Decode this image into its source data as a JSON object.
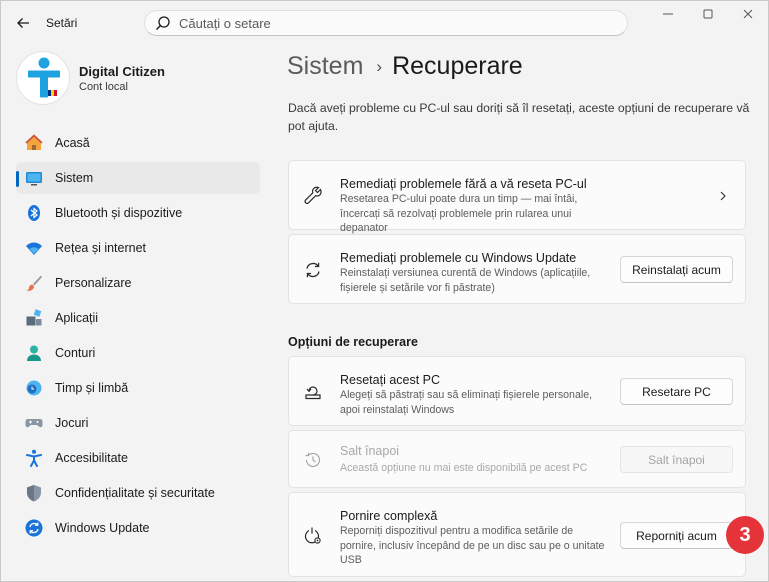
{
  "app": {
    "title": "Setări",
    "search_placeholder": "Căutați o setare"
  },
  "profile": {
    "name": "Digital Citizen",
    "account_type": "Cont local"
  },
  "sidebar": {
    "items": [
      {
        "label": "Acasă",
        "icon": "home-icon"
      },
      {
        "label": "Sistem",
        "icon": "system-icon",
        "active": true
      },
      {
        "label": "Bluetooth și dispozitive",
        "icon": "bluetooth-icon"
      },
      {
        "label": "Rețea și internet",
        "icon": "wifi-icon"
      },
      {
        "label": "Personalizare",
        "icon": "brush-icon"
      },
      {
        "label": "Aplicații",
        "icon": "apps-icon"
      },
      {
        "label": "Conturi",
        "icon": "accounts-icon"
      },
      {
        "label": "Timp și limbă",
        "icon": "time-language-icon"
      },
      {
        "label": "Jocuri",
        "icon": "gamepad-icon"
      },
      {
        "label": "Accesibilitate",
        "icon": "accessibility-icon"
      },
      {
        "label": "Confidențialitate și securitate",
        "icon": "shield-icon"
      },
      {
        "label": "Windows Update",
        "icon": "windows-update-icon"
      }
    ]
  },
  "breadcrumb": {
    "parent": "Sistem",
    "separator": "›",
    "current": "Recuperare"
  },
  "intro": "Dacă aveți probleme cu PC-ul sau doriți să îl resetați, aceste opțiuni de recuperare vă pot ajuta.",
  "cards": {
    "troubleshoot": {
      "title": "Remediați problemele fără a vă reseta PC-ul",
      "desc": "Resetarea PC-ului poate dura un timp — mai întâi, încercați să rezolvați problemele prin rularea unui depanator"
    },
    "windows_update": {
      "title": "Remediați problemele cu Windows Update",
      "desc": "Reinstalați versiunea curentă de Windows (aplicațiile, fișierele și setările vor fi păstrate)",
      "button": "Reinstalați acum"
    }
  },
  "recovery_section": {
    "title": "Opțiuni de recuperare",
    "reset_pc": {
      "title": "Resetați acest PC",
      "desc": "Alegeți să păstrați sau să eliminați fișierele personale, apoi reinstalați Windows",
      "button": "Resetare PC"
    },
    "go_back": {
      "title": "Salt înapoi",
      "desc": "Această opțiune nu mai este disponibilă pe acest PC",
      "button": "Salt înapoi"
    },
    "advanced_startup": {
      "title": "Pornire complexă",
      "desc": "Reporniți dispozitivul pentru a modifica setările de pornire, inclusiv începând de pe un disc sau pe o unitate USB",
      "button": "Reporniți acum"
    }
  },
  "step_badge": "3",
  "colors": {
    "accent": "#0067c0",
    "badge": "#e4343a"
  }
}
